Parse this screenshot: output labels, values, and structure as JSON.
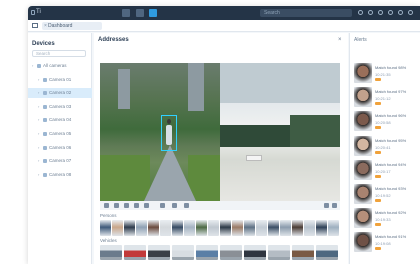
{
  "window": {
    "app_title": "Ti"
  },
  "toolbar": {
    "search_placeholder": "Search"
  },
  "breadcrumb": {
    "tab_label": "Dashboard"
  },
  "sidebar": {
    "title": "Devices",
    "search_placeholder": "Search",
    "items": [
      {
        "label": "All cameras",
        "indent": 0
      },
      {
        "label": "Camera 01",
        "indent": 1
      },
      {
        "label": "Camera 02",
        "indent": 1
      },
      {
        "label": "Camera 03",
        "indent": 1
      },
      {
        "label": "Camera 04",
        "indent": 1
      },
      {
        "label": "Camera 05",
        "indent": 1
      },
      {
        "label": "Camera 06",
        "indent": 1
      },
      {
        "label": "Camera 07",
        "indent": 1
      },
      {
        "label": "Camera 08",
        "indent": 1
      }
    ],
    "active_index": 2
  },
  "main": {
    "title": "Addresses",
    "close_glyph": "×",
    "persons_label": "Persons",
    "vehicles_label": "Vehicles"
  },
  "right_panel": {
    "title": "Alerts",
    "items": [
      {
        "name": "Match found 98%",
        "meta": "10:21:35",
        "face_color": "#9a6f5a"
      },
      {
        "name": "Match found 97%",
        "meta": "10:21:12",
        "face_color": "#c2a18c"
      },
      {
        "name": "Match found 96%",
        "meta": "10:20:58",
        "face_color": "#7c5a4c"
      },
      {
        "name": "Match found 95%",
        "meta": "10:20:41",
        "face_color": "#d3b6a1"
      },
      {
        "name": "Match found 94%",
        "meta": "10:20:17",
        "face_color": "#8b6b5e"
      },
      {
        "name": "Match found 93%",
        "meta": "10:19:52",
        "face_color": "#a98370"
      },
      {
        "name": "Match found 92%",
        "meta": "10:19:33",
        "face_color": "#b58f7a"
      },
      {
        "name": "Match found 91%",
        "meta": "10:19:08",
        "face_color": "#6f5146"
      }
    ]
  },
  "colors": {
    "accent": "#2f9be0",
    "titlebar": "#243447",
    "active_item": "#d9ecfb",
    "alert_tag": "#f0a23b",
    "bbox": "#2fd1ff"
  },
  "person_thumb_colors": [
    "#3f5a7a",
    "#c9a68a",
    "#2e3b4c",
    "#8fa1b4",
    "#6b4b3e",
    "#d4d8dc",
    "#364a63",
    "#a5b3c2",
    "#4d6a45",
    "#bfc7cf",
    "#2d3a48",
    "#9a7a66",
    "#5e7184",
    "#c1cad3",
    "#3c4f66",
    "#8b9cad",
    "#4a3c35",
    "#b7c2cd",
    "#2f4157",
    "#9fb0c0"
  ],
  "car_thumb_colors": [
    "#6b7b8c",
    "#c23a3a",
    "#3a3f47",
    "#d8dde2",
    "#5b7fa6",
    "#8a8f96",
    "#2f3540",
    "#b4bcc4",
    "#7a5a44",
    "#4e6880"
  ]
}
